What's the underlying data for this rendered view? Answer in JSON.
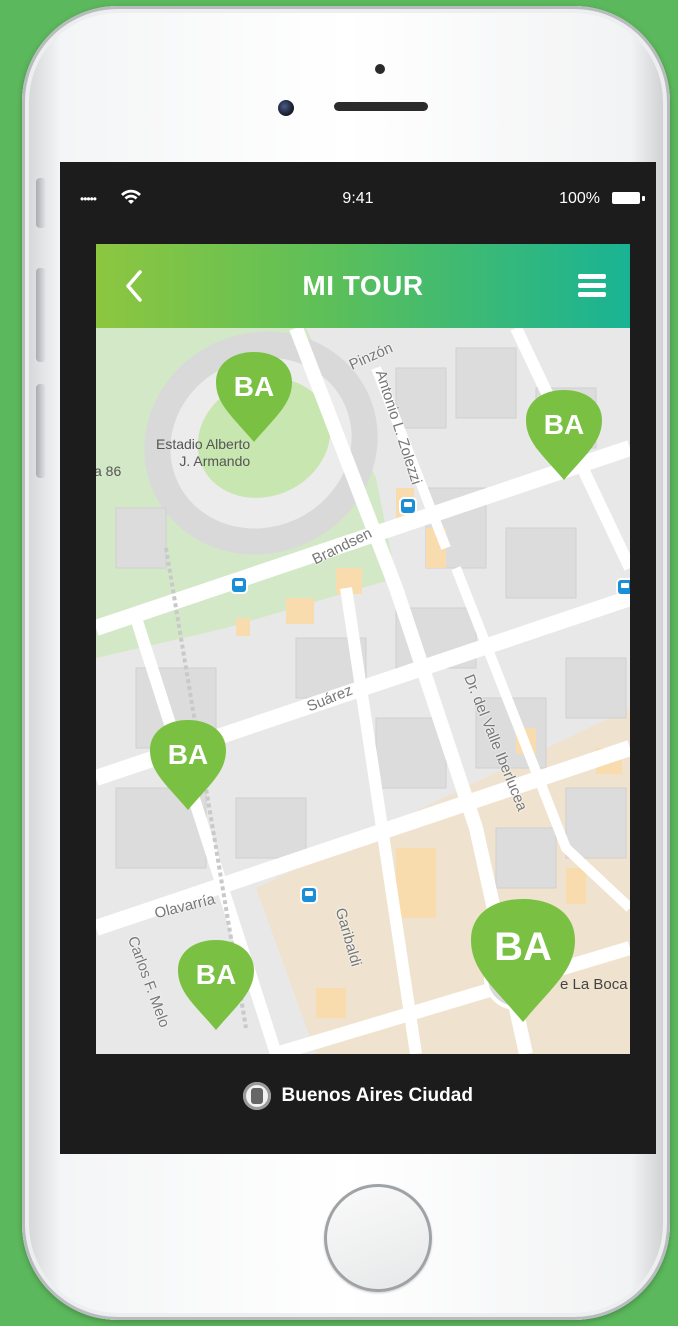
{
  "status_bar": {
    "signal": "•••••",
    "time": "9:41",
    "battery_percent": "100%",
    "wifi_icon": "wifi-icon",
    "battery_icon": "battery-icon"
  },
  "header": {
    "title": "MI TOUR",
    "back_icon": "chevron-left-icon",
    "menu_icon": "hamburger-menu-icon"
  },
  "map": {
    "places": [
      {
        "label": "Estadio Alberto\nJ. Armando"
      },
      {
        "label": "a 86"
      },
      {
        "label": "e La Boca"
      }
    ],
    "streets": [
      "Pinzón",
      "Antonio L. Zolezzi",
      "Brandsen",
      "Suárez",
      "Dr. del Valle Iberlucea",
      "Olavarría",
      "Garibaldi",
      "Carlos F. Melo"
    ],
    "markers": [
      {
        "name": "marker-1",
        "logo": "BA"
      },
      {
        "name": "marker-2",
        "logo": "BA"
      },
      {
        "name": "marker-3",
        "logo": "BA"
      },
      {
        "name": "marker-4",
        "logo": "BA"
      },
      {
        "name": "marker-5-selected",
        "logo": "BA"
      }
    ]
  },
  "footer": {
    "brand": "Buenos Aires Ciudad"
  },
  "colors": {
    "accent_green": "#7ac143",
    "gradient_start": "#8dc63f",
    "gradient_end": "#19b394",
    "background": "#5cb85c"
  }
}
